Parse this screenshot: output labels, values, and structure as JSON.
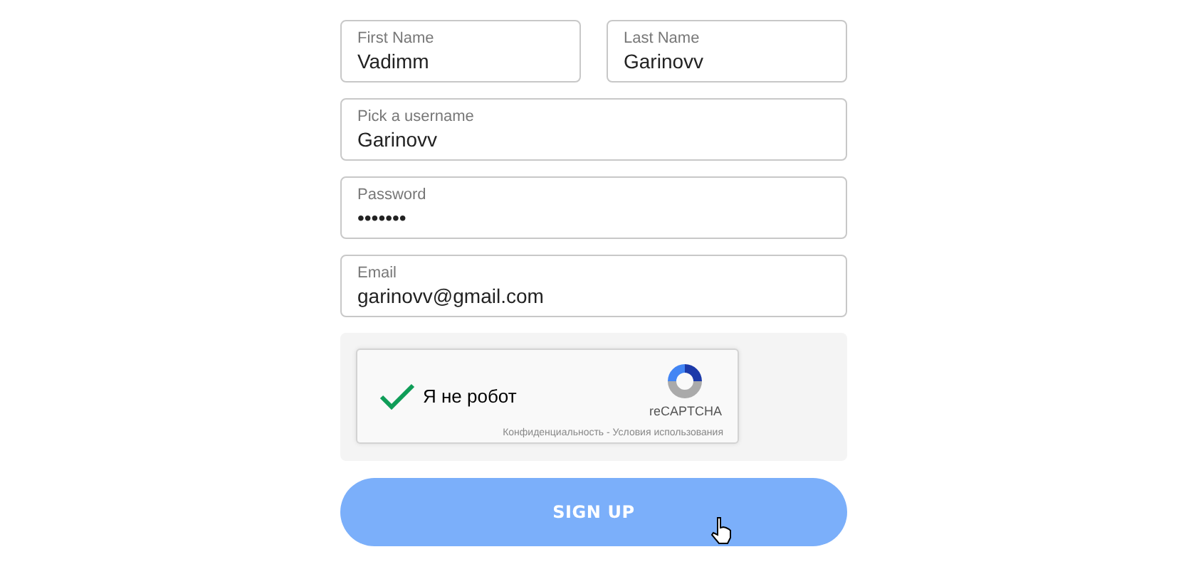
{
  "name_row": [
    {
      "label": "First Name",
      "value": "Vadimm"
    },
    {
      "label": "Last Name",
      "value": "Garinovv"
    }
  ],
  "fields": [
    {
      "label": "Pick a username",
      "value": "Garinovv"
    },
    {
      "label": "Password",
      "value": "•••••••"
    },
    {
      "label": "Email",
      "value": "garinovv@gmail.com"
    }
  ],
  "captcha": {
    "checked": true,
    "label": "Я не робот",
    "brand": "reCAPTCHA",
    "links": "Конфиденциальность - Условия использования"
  },
  "submit": {
    "label": "SIGN UP"
  }
}
